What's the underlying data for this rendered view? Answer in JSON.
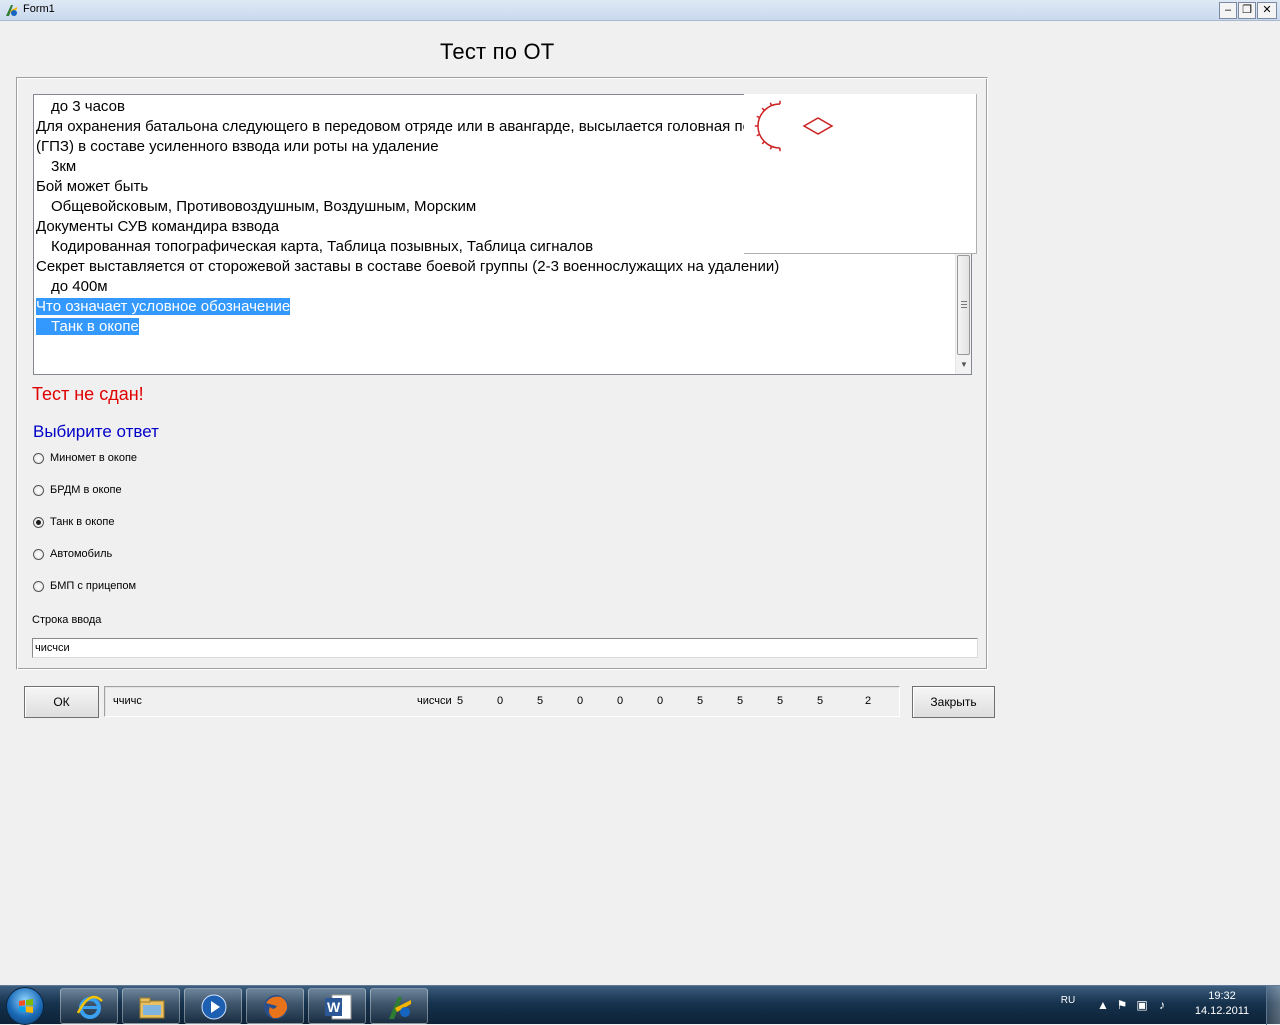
{
  "window": {
    "title": "Form1",
    "controls": {
      "minimize": "–",
      "restore": "❐",
      "close": "✕"
    }
  },
  "heading": "Тест по ОТ",
  "memo": {
    "lines": [
      {
        "text": "до 3 часов",
        "indent": true,
        "selected": false
      },
      {
        "text": "Для охранения батальона следующего в передовом отряде или в авангарде, высылается головная походная застава",
        "indent": false,
        "selected": false
      },
      {
        "text": "(ГПЗ) в составе усиленного взвода или роты на удаление",
        "indent": false,
        "selected": false
      },
      {
        "text": "3км",
        "indent": true,
        "selected": false
      },
      {
        "text": "Бой может быть",
        "indent": false,
        "selected": false
      },
      {
        "text": "Общевойсковым, Противовоздушным, Воздушным, Морским",
        "indent": true,
        "selected": false
      },
      {
        "text": "Документы СУВ командира взвода",
        "indent": false,
        "selected": false
      },
      {
        "text": "Кодированная топографическая карта, Таблица позывных, Таблица сигналов",
        "indent": true,
        "selected": false
      },
      {
        "text": "Секрет выставляется от сторожевой заставы в составе боевой группы (2-3 военнослужащих на удалении)",
        "indent": false,
        "selected": false
      },
      {
        "text": "до 400м",
        "indent": true,
        "selected": false
      },
      {
        "text": "Что означает условное обозначение",
        "indent": false,
        "selected": true
      },
      {
        "text": "Танк в окопе",
        "indent": true,
        "selected": true
      }
    ]
  },
  "symbol_color": "#cc2222",
  "result_text": "Тест не сдан!",
  "choose_label": "Выбирите ответ",
  "options": [
    {
      "label": "Миномет в окопе",
      "checked": false
    },
    {
      "label": "БРДМ в окопе",
      "checked": false
    },
    {
      "label": "Танк в окопе",
      "checked": true
    },
    {
      "label": "Автомобиль",
      "checked": false
    },
    {
      "label": "БМП с прицепом",
      "checked": false
    }
  ],
  "input": {
    "caption": "Строка ввода",
    "value": "чисчси"
  },
  "buttons": {
    "ok": "ОК",
    "close": "Закрыть"
  },
  "status": {
    "left_text": "ччичс",
    "answer_text": "чисчси",
    "numbers": [
      "5",
      "0",
      "5",
      "0",
      "0",
      "0",
      "5",
      "5",
      "5",
      "5",
      "2"
    ]
  },
  "taskbar": {
    "apps": [
      "internet-explorer-icon",
      "file-explorer-icon",
      "media-player-icon",
      "firefox-icon",
      "word-icon",
      "test-app-icon"
    ],
    "tray": {
      "language": "RU",
      "time": "19:32",
      "date": "14.12.2011"
    }
  },
  "colors": {
    "result": "#e00000",
    "choose": "#0000c8",
    "selection": "#3399ff"
  }
}
